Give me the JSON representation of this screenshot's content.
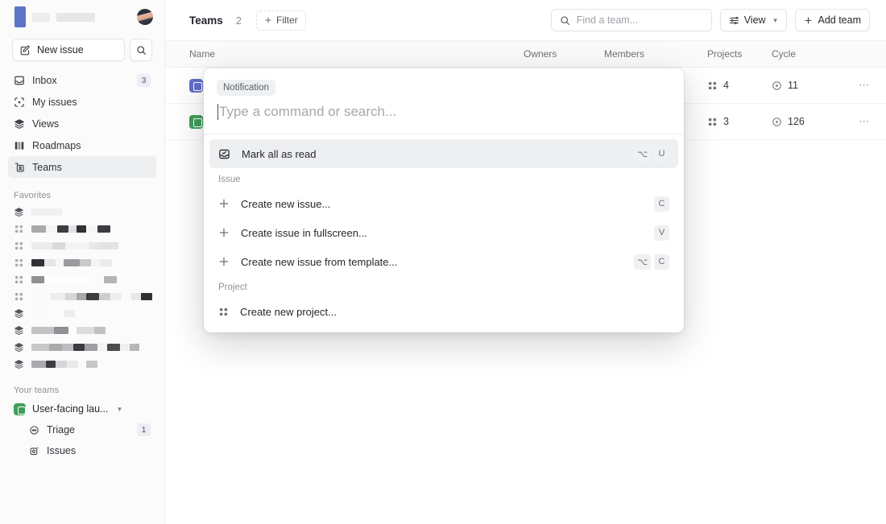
{
  "workspace": {
    "logo_color": "#5b74c4",
    "name_redacted": true,
    "avatar_name": "user-avatar"
  },
  "sidebar": {
    "new_issue_label": "New issue",
    "search_icon": "search-icon",
    "nav": [
      {
        "label": "Inbox",
        "icon": "inbox-icon",
        "badge": "3",
        "active": false
      },
      {
        "label": "My issues",
        "icon": "target-icon",
        "badge": "",
        "active": false
      },
      {
        "label": "Views",
        "icon": "layers-icon",
        "badge": "",
        "active": false
      },
      {
        "label": "Roadmaps",
        "icon": "roadmap-icon",
        "badge": "",
        "active": false
      },
      {
        "label": "Teams",
        "icon": "teams-icon",
        "badge": "",
        "active": true
      }
    ],
    "favorites_title": "Favorites",
    "favorites": [
      {
        "icon": "layers-icon",
        "blocks": [
          [
            38,
            "#f0f0f1"
          ]
        ]
      },
      {
        "icon": "project-icon",
        "blocks": [
          [
            18,
            "#a8a9ab"
          ],
          [
            14,
            "#f4f4f5"
          ],
          [
            14,
            "#3b3d40"
          ],
          [
            10,
            "#e2e2e4"
          ],
          [
            12,
            "#2f3134"
          ],
          [
            14,
            "#f6f6f7"
          ],
          [
            16,
            "#3a3c3f"
          ]
        ]
      },
      {
        "icon": "project-icon",
        "blocks": [
          [
            26,
            "#ececed"
          ],
          [
            16,
            "#d9dadb"
          ],
          [
            30,
            "#f3f3f4"
          ],
          [
            12,
            "#e8e8e9"
          ],
          [
            24,
            "#e3e3e5"
          ]
        ]
      },
      {
        "icon": "project-icon",
        "blocks": [
          [
            16,
            "#303235"
          ],
          [
            14,
            "#e6e6e7"
          ],
          [
            10,
            "#f6f6f7"
          ],
          [
            20,
            "#9a9b9e"
          ],
          [
            14,
            "#c9cacb"
          ],
          [
            12,
            "#f4f4f5"
          ],
          [
            14,
            "#ebebec"
          ]
        ]
      },
      {
        "icon": "project-icon",
        "blocks": [
          [
            16,
            "#8e9092"
          ],
          [
            62,
            "#fdfdfd"
          ],
          [
            12,
            "#fbfbfb"
          ],
          [
            16,
            "#b3b4b6"
          ]
        ]
      },
      {
        "icon": "project-icon",
        "blocks": [
          [
            24,
            "#fafafa"
          ],
          [
            18,
            "#ededee"
          ],
          [
            14,
            "#d6d7d8"
          ],
          [
            12,
            "#a7a8aa"
          ],
          [
            16,
            "#3a3c3f"
          ],
          [
            14,
            "#cdced0"
          ],
          [
            14,
            "#eeeef0"
          ],
          [
            12,
            "#fafafa"
          ],
          [
            12,
            "#e8e8ea"
          ],
          [
            14,
            "#2e3033"
          ]
        ]
      },
      {
        "icon": "layers-icon",
        "blocks": [
          [
            22,
            "#fafafa"
          ],
          [
            18,
            "#fcfcfc"
          ],
          [
            14,
            "#ededee"
          ]
        ]
      },
      {
        "icon": "layers-icon",
        "blocks": [
          [
            28,
            "#c3c4c6"
          ],
          [
            18,
            "#8e9093"
          ],
          [
            10,
            "#fcfcfc"
          ],
          [
            22,
            "#dcdddf"
          ],
          [
            14,
            "#c0c1c3"
          ]
        ]
      },
      {
        "icon": "layers-icon",
        "blocks": [
          [
            22,
            "#c7c8ca"
          ],
          [
            16,
            "#a9aaac"
          ],
          [
            14,
            "#bcbdbf"
          ],
          [
            14,
            "#3a3c3f"
          ],
          [
            16,
            "#9fa0a2"
          ],
          [
            12,
            "#f4f4f5"
          ],
          [
            16,
            "#4a4c50"
          ],
          [
            12,
            "#f0f0f1"
          ],
          [
            12,
            "#b6b7b9"
          ]
        ]
      },
      {
        "icon": "layers-icon",
        "blocks": [
          [
            18,
            "#a9aaad"
          ],
          [
            12,
            "#3c3e41"
          ],
          [
            14,
            "#d4d5d7"
          ],
          [
            14,
            "#eaeaeb"
          ],
          [
            10,
            "#fbfbfb"
          ],
          [
            14,
            "#c5c6c8"
          ]
        ]
      }
    ],
    "your_teams_title": "Your teams",
    "team": {
      "name": "User-facing lau...",
      "icon": "team-icon",
      "color": "#3f9e5a",
      "chevron": "chevron-down-icon",
      "children": [
        {
          "label": "Triage",
          "icon": "triage-icon",
          "badge": "1"
        },
        {
          "label": "Issues",
          "icon": "issues-icon",
          "badge": ""
        }
      ]
    }
  },
  "topbar": {
    "title": "Teams",
    "count": "2",
    "filter_label": "Filter",
    "filter_icon": "plus-icon",
    "search_placeholder": "Find a team...",
    "search_icon": "search-icon",
    "view_label": "View",
    "view_icon": "sliders-icon",
    "view_chevron": "chevron-down-icon",
    "add_team_label": "Add team",
    "add_team_icon": "plus-icon"
  },
  "table": {
    "columns": [
      "Name",
      "Owners",
      "Members",
      "Projects",
      "Cycle"
    ],
    "rows": [
      {
        "icon_color": "#6370c8",
        "name_redacted": true,
        "owners": "",
        "members": "",
        "projects": "4",
        "cycle": "11",
        "more_icon": "ellipsis-icon"
      },
      {
        "icon_color": "#3f9e5a",
        "name_redacted": true,
        "owners": "",
        "members": "",
        "projects": "3",
        "cycle": "126",
        "more_icon": "ellipsis-icon"
      }
    ]
  },
  "palette": {
    "context_chip": "Notification",
    "input_value": "",
    "input_placeholder": "Type a command or search...",
    "groups": [
      {
        "label": "",
        "items": [
          {
            "label": "Mark all as read",
            "icon": "inbox-check-icon",
            "keys": [
              "⌥",
              "U"
            ],
            "selected": true
          }
        ]
      },
      {
        "label": "Issue",
        "items": [
          {
            "label": "Create new issue...",
            "icon": "plus-icon",
            "keys": [
              "C"
            ],
            "selected": false
          },
          {
            "label": "Create issue in fullscreen...",
            "icon": "plus-icon",
            "keys": [
              "V"
            ],
            "selected": false
          },
          {
            "label": "Create new issue from template...",
            "icon": "plus-icon",
            "keys": [
              "⌥",
              "C"
            ],
            "selected": false
          }
        ]
      },
      {
        "label": "Project",
        "items": [
          {
            "label": "Create new project...",
            "icon": "project-icon",
            "keys": [],
            "selected": false
          }
        ]
      }
    ]
  }
}
